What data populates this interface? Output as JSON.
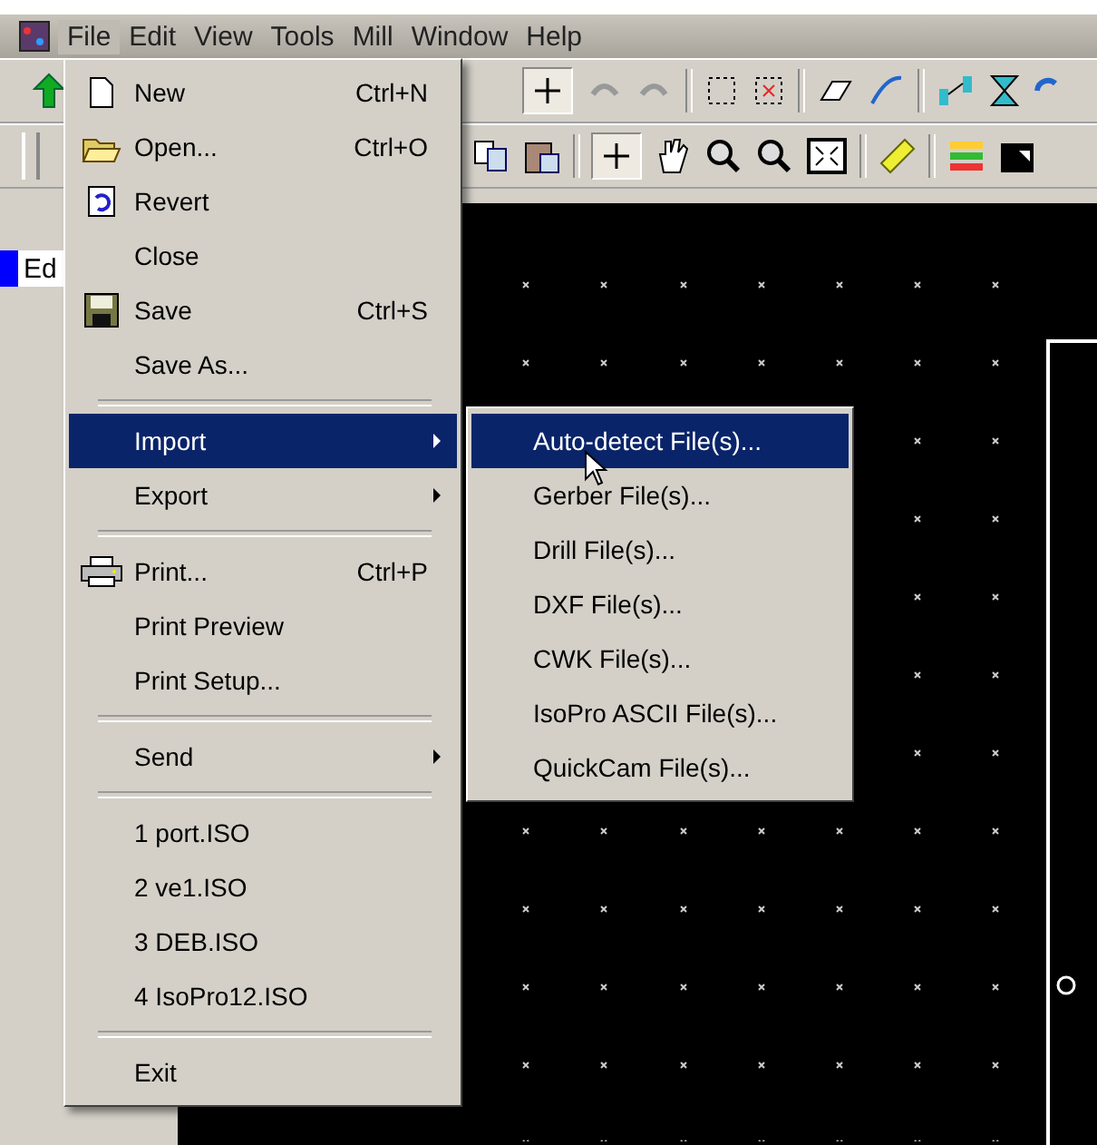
{
  "menubar": [
    {
      "label": "File",
      "selected": true
    },
    {
      "label": "Edit",
      "selected": false
    },
    {
      "label": "View",
      "selected": false
    },
    {
      "label": "Tools",
      "selected": false
    },
    {
      "label": "Mill",
      "selected": false
    },
    {
      "label": "Window",
      "selected": false
    },
    {
      "label": "Help",
      "selected": false
    }
  ],
  "side_field": {
    "value": "Ed"
  },
  "file_menu": [
    {
      "kind": "item",
      "label": "New",
      "shortcut": "Ctrl+N",
      "submenu": false,
      "selected": false
    },
    {
      "kind": "item",
      "label": "Open...",
      "shortcut": "Ctrl+O",
      "submenu": false,
      "selected": false
    },
    {
      "kind": "item",
      "label": "Revert",
      "submenu": false,
      "selected": false
    },
    {
      "kind": "item",
      "label": "Close",
      "submenu": false,
      "selected": false
    },
    {
      "kind": "item",
      "label": "Save",
      "shortcut": "Ctrl+S",
      "submenu": false,
      "selected": false
    },
    {
      "kind": "item",
      "label": "Save As...",
      "submenu": false,
      "selected": false
    },
    {
      "kind": "separator"
    },
    {
      "kind": "item",
      "label": "Import",
      "submenu": true,
      "selected": true
    },
    {
      "kind": "item",
      "label": "Export",
      "submenu": true,
      "selected": false
    },
    {
      "kind": "separator"
    },
    {
      "kind": "item",
      "label": "Print...",
      "shortcut": "Ctrl+P",
      "submenu": false,
      "selected": false
    },
    {
      "kind": "item",
      "label": "Print Preview",
      "submenu": false,
      "selected": false
    },
    {
      "kind": "item",
      "label": "Print Setup...",
      "submenu": false,
      "selected": false
    },
    {
      "kind": "separator"
    },
    {
      "kind": "item",
      "label": "Send",
      "submenu": true,
      "selected": false
    },
    {
      "kind": "separator"
    },
    {
      "kind": "item",
      "label": "1 port.ISO",
      "submenu": false,
      "selected": false
    },
    {
      "kind": "item",
      "label": "2 ve1.ISO",
      "submenu": false,
      "selected": false
    },
    {
      "kind": "item",
      "label": "3 DEB.ISO",
      "submenu": false,
      "selected": false
    },
    {
      "kind": "item",
      "label": "4 IsoPro12.ISO",
      "submenu": false,
      "selected": false
    },
    {
      "kind": "separator"
    },
    {
      "kind": "item",
      "label": "Exit",
      "submenu": false,
      "selected": false
    }
  ],
  "import_submenu": [
    {
      "label": "Auto-detect File(s)...",
      "selected": true
    },
    {
      "label": "Gerber File(s)...",
      "selected": false
    },
    {
      "label": "Drill File(s)...",
      "selected": false
    },
    {
      "label": "DXF File(s)...",
      "selected": false
    },
    {
      "label": "CWK File(s)...",
      "selected": false
    },
    {
      "label": "IsoPro ASCII File(s)...",
      "selected": false
    },
    {
      "label": "QuickCam File(s)...",
      "selected": false
    }
  ]
}
